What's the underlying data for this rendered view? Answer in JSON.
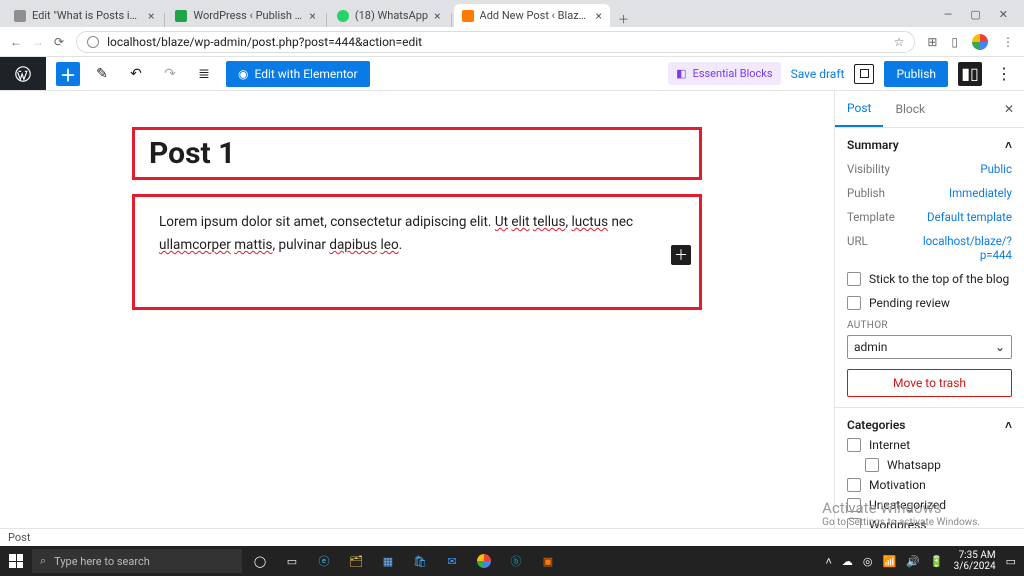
{
  "browser": {
    "tabs": [
      {
        "title": "Edit \"What is Posts in WordPress\"",
        "favicon": "#8e8e8e"
      },
      {
        "title": "WordPress ‹ Publish Posts",
        "favicon": "#1fa548"
      },
      {
        "title": "(18) WhatsApp",
        "favicon": "#25d366"
      },
      {
        "title": "Add New Post ‹ Blaze — WordPress",
        "favicon": "#ff7a00",
        "active": true
      }
    ],
    "url": "localhost/blaze/wp-admin/post.php?post=444&action=edit"
  },
  "toolbar": {
    "elementor_label": "Edit with Elementor",
    "essential_blocks_label": "Essential Blocks",
    "save_draft_label": "Save draft",
    "publish_label": "Publish"
  },
  "post": {
    "title": "Post 1",
    "body_plain": "Lorem ipsum dolor sit amet, consectetur adipiscing elit. Ut elit tellus, luctus nec ullamcorper mattis, pulvinar dapibus leo."
  },
  "sidebar": {
    "tab_post": "Post",
    "tab_block": "Block",
    "summary": {
      "title": "Summary",
      "visibility_label": "Visibility",
      "visibility_value": "Public",
      "publish_label": "Publish",
      "publish_value": "Immediately",
      "template_label": "Template",
      "template_value": "Default template",
      "url_label": "URL",
      "url_value": "localhost/blaze/?p=444",
      "sticky_label": "Stick to the top of the blog",
      "pending_label": "Pending review",
      "author_heading": "AUTHOR",
      "author_value": "admin",
      "trash_label": "Move to trash"
    },
    "categories": {
      "title": "Categories",
      "items": [
        "Internet",
        "Whatsapp",
        "Motivation",
        "Uncategorized",
        "Wordpress"
      ]
    }
  },
  "status_strip": "Post",
  "watermark": {
    "title": "Activate Windows",
    "sub": "Go to Settings to activate Windows."
  },
  "taskbar": {
    "search_placeholder": "Type here to search",
    "time": "7:35 AM",
    "date": "3/6/2024"
  }
}
